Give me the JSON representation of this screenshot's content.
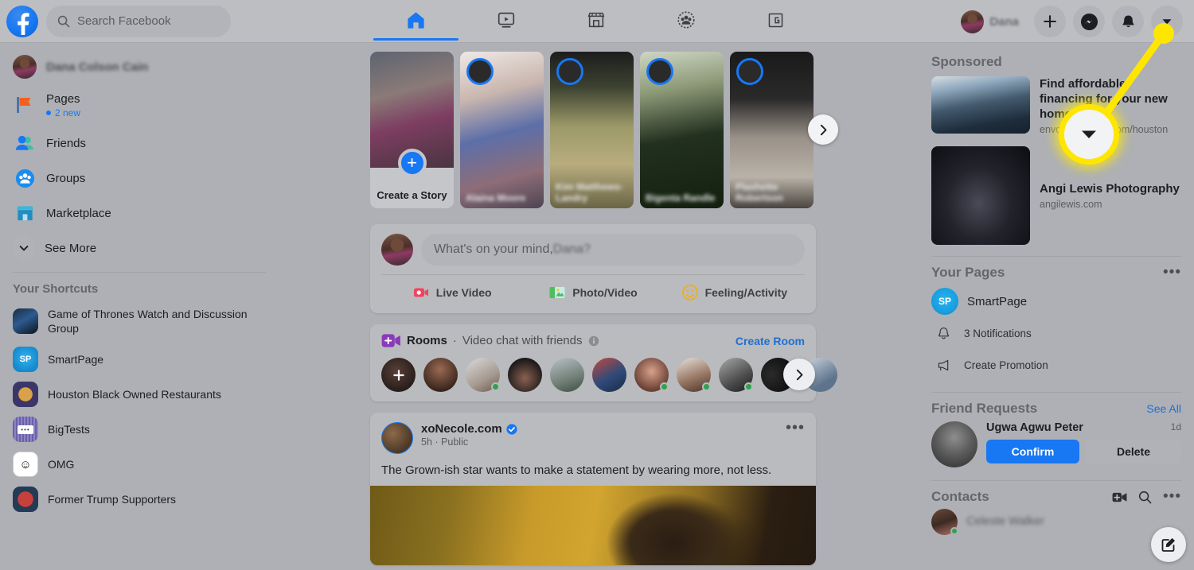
{
  "topbar": {
    "logo_alt": "Facebook",
    "search_placeholder": "Search Facebook",
    "tabs": [
      {
        "name": "home",
        "icon": "home-icon",
        "active": true
      },
      {
        "name": "watch",
        "icon": "watch-icon",
        "active": false
      },
      {
        "name": "marketplace",
        "icon": "marketplace-icon",
        "active": false
      },
      {
        "name": "groups",
        "icon": "groups-icon",
        "active": false
      },
      {
        "name": "gaming",
        "icon": "gaming-icon",
        "active": false
      }
    ],
    "account_name": "Dana",
    "actions": [
      {
        "name": "create-menu",
        "icon": "plus-icon"
      },
      {
        "name": "messenger",
        "icon": "messenger-icon"
      },
      {
        "name": "notifications",
        "icon": "bell-icon"
      },
      {
        "name": "account-menu",
        "icon": "chevron-down-icon"
      }
    ]
  },
  "sidebar": {
    "profile_name": "Dana Colson Cain",
    "items": [
      {
        "label": "Pages",
        "sub": "2 new",
        "icon": "pages-flag-icon"
      },
      {
        "label": "Friends",
        "sub": "",
        "icon": "friends-icon"
      },
      {
        "label": "Groups",
        "sub": "",
        "icon": "groups-icon"
      },
      {
        "label": "Marketplace",
        "sub": "",
        "icon": "marketplace-icon"
      },
      {
        "label": "See More",
        "sub": "",
        "icon": "chevron-down-icon"
      }
    ],
    "shortcuts_title": "Your Shortcuts",
    "shortcuts": [
      {
        "label": "Game of Thrones Watch and Discussion Group"
      },
      {
        "label": "SmartPage"
      },
      {
        "label": "Houston Black Owned Restaurants"
      },
      {
        "label": "BigTests"
      },
      {
        "label": "OMG"
      },
      {
        "label": "Former Trump Supporters"
      }
    ]
  },
  "feed": {
    "stories": {
      "create": {
        "title": "Create a Story",
        "icon": "plus-icon"
      },
      "items": [
        {
          "name": "Alaina Moore"
        },
        {
          "name": "Kim Matthews-Landry"
        },
        {
          "name": "Bigenta Randle"
        },
        {
          "name": "Plashette Robertson"
        }
      ],
      "next_icon": "chevron-right-icon"
    },
    "composer": {
      "placeholder_prefix": "What's on your mind, ",
      "placeholder_name": "Dana?",
      "actions": [
        {
          "label": "Live Video",
          "icon": "live-video-icon"
        },
        {
          "label": "Photo/Video",
          "icon": "photo-video-icon"
        },
        {
          "label": "Feeling/Activity",
          "icon": "feeling-activity-icon"
        }
      ]
    },
    "rooms": {
      "title": "Rooms",
      "separator": "·",
      "subtitle": "Video chat with friends",
      "info_icon": "info-icon",
      "create_label": "Create Room",
      "next_icon": "chevron-right-icon"
    },
    "post": {
      "author": "xoNecole.com",
      "verified_icon": "verified-badge-icon",
      "time": "5h",
      "separator": "·",
      "privacy": "Public",
      "menu_icon": "ellipsis-icon",
      "text": "The Grown-ish star wants to make a statement by wearing more, not less."
    }
  },
  "right": {
    "sponsored_title": "Sponsored",
    "ads": [
      {
        "title": "Find affordable financing for your new home",
        "url": "envoymortgage.com/houston"
      },
      {
        "title": "Angi Lewis Photography",
        "url": "angilewis.com"
      }
    ],
    "pages_title": "Your Pages",
    "pages_menu_icon": "ellipsis-icon",
    "page_name": "SmartPage",
    "page_initials": "SP",
    "page_rows": [
      {
        "label": "3 Notifications",
        "icon": "bell-icon"
      },
      {
        "label": "Create Promotion",
        "icon": "megaphone-icon"
      }
    ],
    "requests_title": "Friend Requests",
    "requests_see_all": "See All",
    "request": {
      "name": "Ugwa Agwu Peter",
      "time": "1d",
      "confirm_label": "Confirm",
      "delete_label": "Delete"
    },
    "contacts_title": "Contacts",
    "contacts_icons": [
      {
        "name": "video-room-icon"
      },
      {
        "name": "search-icon"
      },
      {
        "name": "ellipsis-icon"
      }
    ],
    "contacts": [
      {
        "name": "Celeste Walker",
        "online": true
      }
    ],
    "compose_icon": "compose-message-icon"
  },
  "annotation": {
    "target_icon": "chevron-down-icon",
    "highlight_color": "#ffe600"
  }
}
